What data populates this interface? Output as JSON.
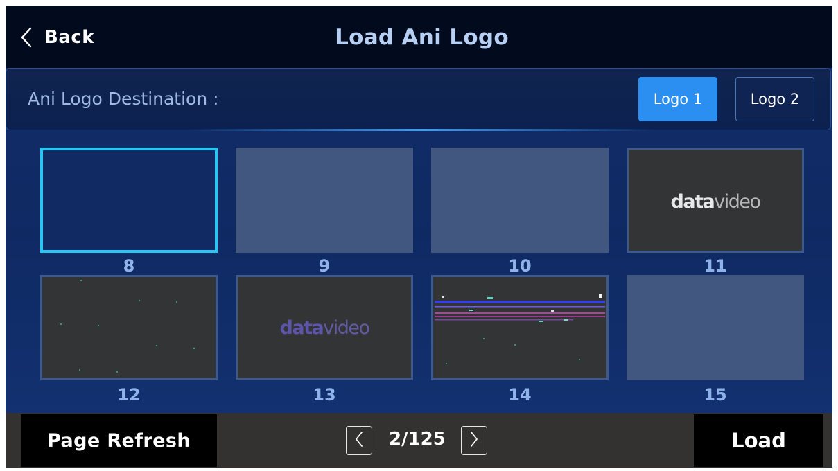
{
  "header": {
    "back_label": "Back",
    "title": "Load Ani Logo"
  },
  "destination": {
    "label": "Ani Logo Destination :",
    "options": [
      {
        "label": "Logo 1",
        "selected": true
      },
      {
        "label": "Logo 2",
        "selected": false
      }
    ]
  },
  "thumbnails": [
    {
      "number": "8",
      "content": "empty",
      "selected": true
    },
    {
      "number": "9",
      "content": "blank"
    },
    {
      "number": "10",
      "content": "blank"
    },
    {
      "number": "11",
      "content": "datavideo logo (white)",
      "logo_text_bold": "data",
      "logo_text_outline": "video"
    },
    {
      "number": "12",
      "content": "dark with green particles"
    },
    {
      "number": "13",
      "content": "datavideo logo (purple)",
      "logo_text_bold": "data",
      "logo_text_outline": "video"
    },
    {
      "number": "14",
      "content": "glitch lines animation"
    },
    {
      "number": "15",
      "content": "blank"
    }
  ],
  "footer": {
    "refresh_label": "Page Refresh",
    "page_indicator": "2/125",
    "load_label": "Load"
  },
  "colors": {
    "accent_blue": "#2b8ff2",
    "selection_cyan": "#26c7f3",
    "title_color": "#b6cff2",
    "number_color": "#8fb2ea"
  },
  "icons": {
    "back": "chevron-left-icon",
    "prev_page": "chevron-left-icon",
    "next_page": "chevron-right-icon"
  }
}
